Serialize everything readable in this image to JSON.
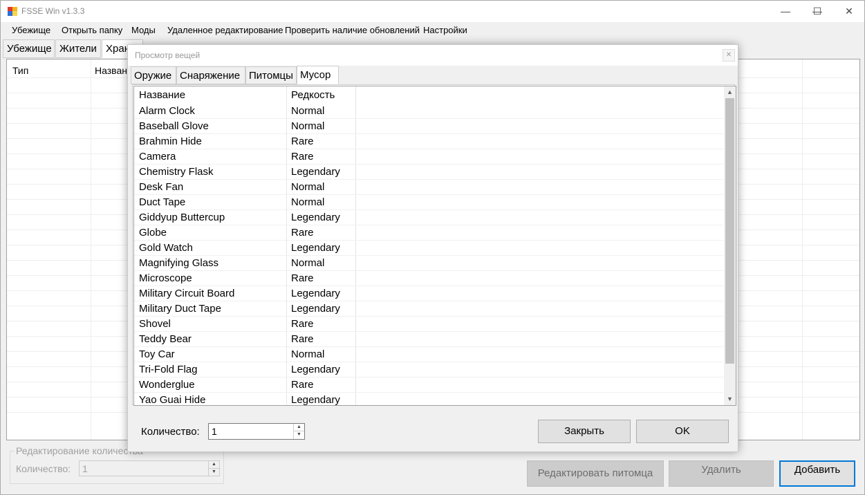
{
  "window": {
    "title": "FSSE Win v1.3.3",
    "minimize": "—",
    "maximize": "☐",
    "close": "✕"
  },
  "menu": [
    "Убежище",
    "Открыть папку",
    "Моды",
    "Удаленное редактирование",
    "Проверить наличие обновлений",
    "Настройки"
  ],
  "main_tabs": [
    "Убежище",
    "Жители",
    "Хран"
  ],
  "main_list": {
    "headers": [
      "Тип",
      "Назван"
    ]
  },
  "edit_group": {
    "legend": "Редактирование количества",
    "quantity_label": "Количество:",
    "quantity_value": "1"
  },
  "bottom_buttons": {
    "edit_pet": "Редактировать питомца",
    "delete": "Удалить",
    "add": "Добавить"
  },
  "dialog": {
    "title": "Просмотр вещей",
    "tabs": [
      "Оружие",
      "Снаряжение",
      "Питомцы",
      "Мусор"
    ],
    "active_tab": "Мусор",
    "headers": {
      "name": "Название",
      "rarity": "Редкость"
    },
    "items": [
      {
        "name": "Alarm Clock",
        "rarity": "Normal"
      },
      {
        "name": "Baseball Glove",
        "rarity": "Normal"
      },
      {
        "name": "Brahmin Hide",
        "rarity": "Rare"
      },
      {
        "name": "Camera",
        "rarity": "Rare"
      },
      {
        "name": "Chemistry Flask",
        "rarity": "Legendary"
      },
      {
        "name": "Desk Fan",
        "rarity": "Normal"
      },
      {
        "name": "Duct Tape",
        "rarity": "Normal"
      },
      {
        "name": "Giddyup Buttercup",
        "rarity": "Legendary"
      },
      {
        "name": "Globe",
        "rarity": "Rare"
      },
      {
        "name": "Gold Watch",
        "rarity": "Legendary"
      },
      {
        "name": "Magnifying Glass",
        "rarity": "Normal"
      },
      {
        "name": "Microscope",
        "rarity": "Rare"
      },
      {
        "name": "Military Circuit Board",
        "rarity": "Legendary"
      },
      {
        "name": "Military Duct Tape",
        "rarity": "Legendary"
      },
      {
        "name": "Shovel",
        "rarity": "Rare"
      },
      {
        "name": "Teddy Bear",
        "rarity": "Rare"
      },
      {
        "name": "Toy Car",
        "rarity": "Normal"
      },
      {
        "name": "Tri-Fold Flag",
        "rarity": "Legendary"
      },
      {
        "name": "Wonderglue",
        "rarity": "Rare"
      },
      {
        "name": "Yao Guai Hide",
        "rarity": "Legendary"
      }
    ],
    "quantity_label": "Количество:",
    "quantity_value": "1",
    "close_button": "Закрыть",
    "ok_button": "OK"
  }
}
